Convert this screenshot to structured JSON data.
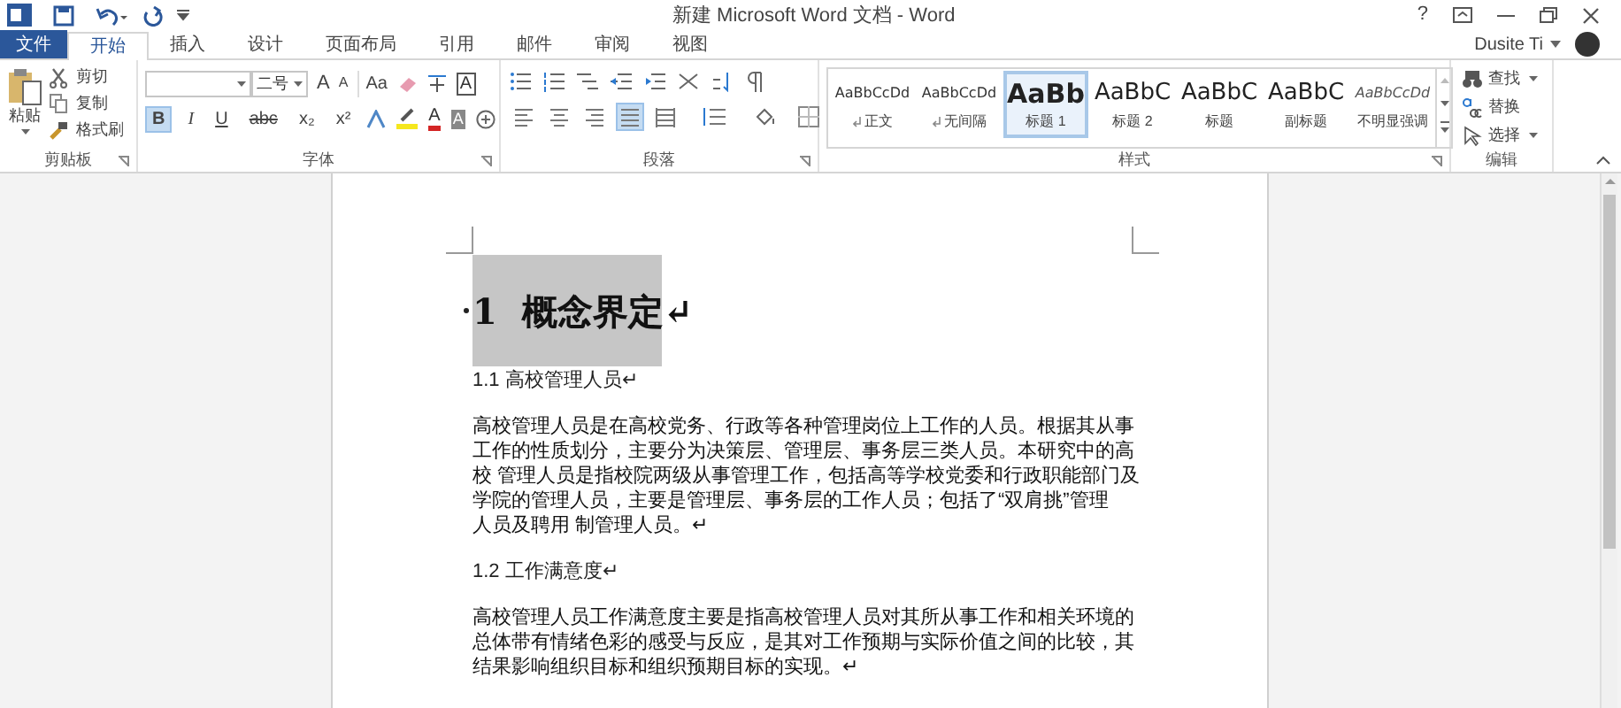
{
  "window": {
    "title": "新建 Microsoft Word 文档 - Word",
    "help": "?"
  },
  "tabs": [
    {
      "label": "文件",
      "kind": "file",
      "selected": false
    },
    {
      "label": "开始",
      "kind": "tab",
      "selected": true
    },
    {
      "label": "插入",
      "kind": "tab",
      "selected": false
    },
    {
      "label": "设计",
      "kind": "tab",
      "selected": false
    },
    {
      "label": "页面布局",
      "kind": "tab",
      "selected": false
    },
    {
      "label": "引用",
      "kind": "tab",
      "selected": false
    },
    {
      "label": "邮件",
      "kind": "tab",
      "selected": false
    },
    {
      "label": "审阅",
      "kind": "tab",
      "selected": false
    },
    {
      "label": "视图",
      "kind": "tab",
      "selected": false
    }
  ],
  "user": {
    "name": "Dusite Ti"
  },
  "clipboard": {
    "paste": "粘贴",
    "actions": [
      "剪切",
      "复制",
      "格式刷"
    ],
    "label": "剪贴板"
  },
  "font": {
    "size": "二号",
    "grow": "A",
    "shrink": "A",
    "case": "Aa",
    "label": "字体",
    "format_buttons": [
      {
        "label": "B",
        "selected": true
      },
      {
        "label": "I",
        "selected": false
      },
      {
        "label": "U",
        "selected": false
      },
      {
        "label": "abc",
        "selected": false
      },
      {
        "label": "x₂",
        "selected": false
      },
      {
        "label": "x²",
        "selected": false
      }
    ],
    "border_char": "A",
    "color_a": "A",
    "shade_a": "A"
  },
  "paragraph": {
    "label": "段落",
    "alignment": [
      {
        "selected": false
      },
      {
        "selected": false
      },
      {
        "selected": false
      },
      {
        "selected": true
      },
      {
        "selected": false
      }
    ]
  },
  "styles": {
    "label": "样式",
    "items": [
      {
        "preview": "AaBbCcDd",
        "name": "正文",
        "kind": "small",
        "mark": true,
        "selected": false
      },
      {
        "preview": "AaBbCcDd",
        "name": "无间隔",
        "kind": "small",
        "mark": true,
        "selected": false
      },
      {
        "preview": "AaBb",
        "name": "标题 1",
        "kind": "heading",
        "mark": false,
        "selected": true
      },
      {
        "preview": "AaBbC",
        "name": "标题 2",
        "kind": "large",
        "mark": false,
        "selected": false
      },
      {
        "preview": "AaBbC",
        "name": "标题",
        "kind": "large",
        "mark": false,
        "selected": false
      },
      {
        "preview": "AaBbC",
        "name": "副标题",
        "kind": "large",
        "mark": false,
        "selected": false
      },
      {
        "preview": "AaBbCcDd",
        "name": "不明显强调",
        "kind": "italic",
        "mark": false,
        "selected": false
      }
    ]
  },
  "editing": {
    "label": "编辑",
    "actions": [
      {
        "label": "查找",
        "kind": "find"
      },
      {
        "label": "替换",
        "kind": "replace"
      },
      {
        "label": "选择",
        "kind": "select"
      }
    ]
  },
  "document": {
    "blocks": [
      {
        "kind": "heading1",
        "text": "1  概念界定↵"
      },
      {
        "kind": "heading2",
        "text": "1.1 高校管理人员↵"
      },
      {
        "kind": "body",
        "lines": [
          "高校管理人员是在高校党务、行政等各种管理岗位上工作的人员。根据其从事",
          "工作的性质划分，主要分为决策层、管理层、事务层三类人员。本研究中的高",
          "校 管理人员是指校院两级从事管理工作，包括高等学校党委和行政职能部门及",
          "学院的管理人员，主要是管理层、事务层的工作人员；包括了“双肩挑”管理",
          "人员及聘用 制管理人员。↵"
        ]
      },
      {
        "kind": "heading2",
        "text": "1.2 工作满意度↵"
      },
      {
        "kind": "body",
        "lines": [
          "高校管理人员工作满意度主要是指高校管理人员对其所从事工作和相关环境的",
          "总体带有情绪色彩的感受与反应，是其对工作预期与实际价值之间的比较，其",
          "结果影响组织目标和组织预期目标的实现。↵"
        ]
      }
    ]
  }
}
